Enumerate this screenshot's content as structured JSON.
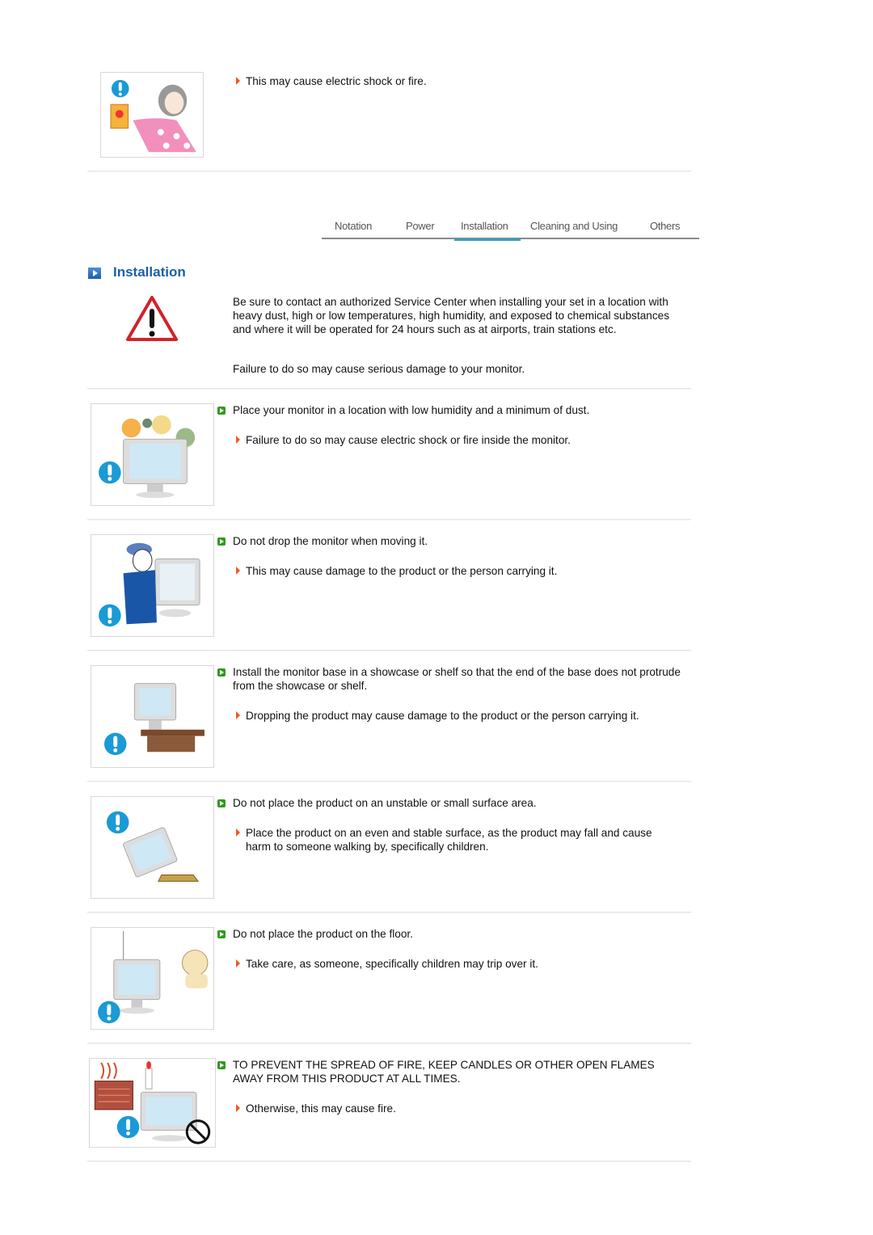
{
  "top_item": {
    "image": "woman-unplugging-cord-illustration",
    "note": "This may cause electric shock or fire."
  },
  "tabs": [
    {
      "label": "Notation",
      "active": false
    },
    {
      "label": "Power",
      "active": false
    },
    {
      "label": "Installation",
      "active": true
    },
    {
      "label": "Cleaning and Using",
      "active": false
    },
    {
      "label": "Others",
      "active": false
    }
  ],
  "section": {
    "title": "Installation",
    "intro_paragraphs": [
      "Be sure to contact an authorized Service Center when installing your set in a location with heavy dust, high or low temperatures, high humidity, and exposed to chemical substances and where it will be operated for 24 hours such as at airports, train stations etc.",
      "Failure to do so may cause serious damage to your monitor."
    ]
  },
  "items": [
    {
      "image": "monitor-dust-illustration",
      "instruction": "Place your monitor in a location with low humidity and a minimum of dust.",
      "note": "Failure to do so may cause electric shock or fire inside the monitor."
    },
    {
      "image": "man-carrying-monitor-illustration",
      "instruction": "Do not drop the monitor when moving it.",
      "note": "This may cause damage to the product or the person carrying it."
    },
    {
      "image": "monitor-on-shelf-illustration",
      "instruction": "Install the monitor base in a showcase or shelf so that the end of the base does not protrude from the showcase or shelf.",
      "note": "Dropping the product may cause damage to the product or the person carrying it."
    },
    {
      "image": "monitor-tipping-illustration",
      "instruction": "Do not place the product on an unstable or small surface area.",
      "note": "Place the product on an even and stable surface, as the product may fall and cause harm to someone walking by, specifically children."
    },
    {
      "image": "monitor-on-floor-with-child-illustration",
      "instruction": "Do not place the product on the floor.",
      "note": "Take care, as someone, specifically children may trip over it."
    },
    {
      "image": "monitor-near-flames-illustration",
      "instruction": "TO PREVENT THE SPREAD OF FIRE, KEEP CANDLES OR OTHER OPEN FLAMES AWAY FROM THIS PRODUCT AT ALL TIMES.",
      "note": "Otherwise, this may cause fire."
    }
  ],
  "colors": {
    "heading": "#1a5fa8",
    "tab_active_underline": "#3a9fc0",
    "bullet_green": "#2f9a1e",
    "arrow_orange": "#f05a1e",
    "warning_red": "#d0232a",
    "info_blue": "#1a9ad6"
  }
}
